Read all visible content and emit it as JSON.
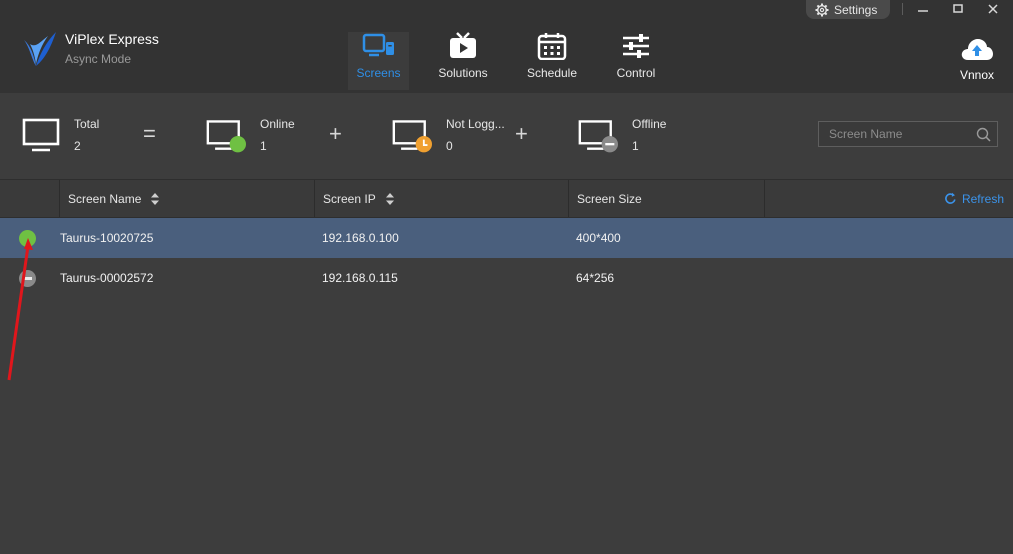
{
  "app": {
    "title": "ViPlex Express",
    "subtitle": "Async Mode"
  },
  "window": {
    "settings_label": "Settings"
  },
  "nav": [
    {
      "label": "Screens",
      "icon": "screens-icon",
      "active": true
    },
    {
      "label": "Solutions",
      "icon": "solutions-icon",
      "active": false
    },
    {
      "label": "Schedule",
      "icon": "schedule-icon",
      "active": false
    },
    {
      "label": "Control",
      "icon": "control-icon",
      "active": false
    }
  ],
  "cloud": {
    "label": "Vnnox",
    "icon": "cloud-upload-icon"
  },
  "summary": {
    "total": {
      "label": "Total",
      "value": "2"
    },
    "equals": "=",
    "plus": "+",
    "online": {
      "label": "Online",
      "value": "1"
    },
    "not_logged": {
      "label": "Not Logg...",
      "value": "0"
    },
    "offline": {
      "label": "Offline",
      "value": "1"
    }
  },
  "search": {
    "placeholder": "Screen Name"
  },
  "table": {
    "columns": [
      "Screen Name",
      "Screen IP",
      "Screen Size"
    ],
    "refresh_label": "Refresh",
    "rows": [
      {
        "status": "online",
        "name": "Taurus-10020725",
        "ip": "192.168.0.100",
        "size": "400*400",
        "selected": true
      },
      {
        "status": "offline",
        "name": "Taurus-00002572",
        "ip": "192.168.0.115",
        "size": "64*256",
        "selected": false
      }
    ]
  },
  "colors": {
    "accent": "#2f8fe6",
    "online": "#6fc043",
    "not_logged": "#f0a030",
    "offline": "#8a8a8a",
    "selected_row": "#4a5f7d",
    "annotation": "#e0161c"
  }
}
